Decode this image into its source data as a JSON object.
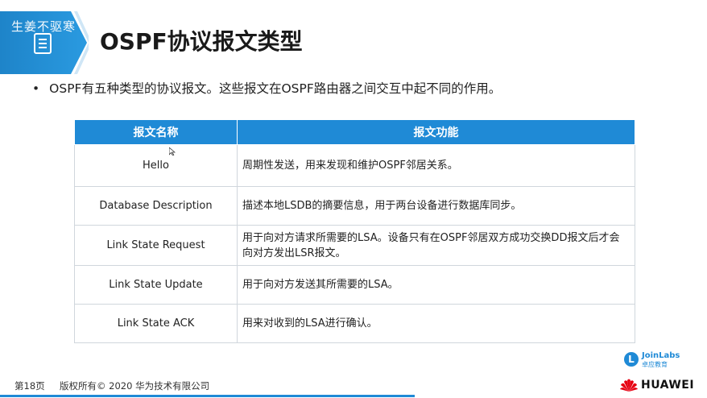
{
  "watermark": "生姜不驱寒",
  "header": {
    "title": "OSPF协议报文类型"
  },
  "bullet": {
    "text": "OSPF有五种类型的协议报文。这些报文在OSPF路由器之间交互中起不同的作用。"
  },
  "table": {
    "headers": [
      "报文名称",
      "报文功能"
    ],
    "rows": [
      {
        "name": "Hello",
        "desc": "周期性发送，用来发现和维护OSPF邻居关系。"
      },
      {
        "name": "Database Description",
        "desc": "描述本地LSDB的摘要信息，用于两台设备进行数据库同步。"
      },
      {
        "name": "Link State Request",
        "desc": "用于向对方请求所需要的LSA。设备只有在OSPF邻居双方成功交换DD报文后才会向对方发出LSR报文。"
      },
      {
        "name": "Link State Update",
        "desc": "用于向对方发送其所需要的LSA。"
      },
      {
        "name": "Link State ACK",
        "desc": "用来对收到的LSA进行确认。"
      }
    ]
  },
  "footer": {
    "page": "第18页",
    "copyright": "版权所有© 2020 华为技术有限公司"
  },
  "logos": {
    "joinlabs_name": "JoinLabs",
    "joinlabs_sub": "卓应教育",
    "joinlabs_letter": "L",
    "huawei": "HUAWEI"
  },
  "colors": {
    "accent": "#1f8ad6",
    "huawei_red": "#e60012"
  }
}
